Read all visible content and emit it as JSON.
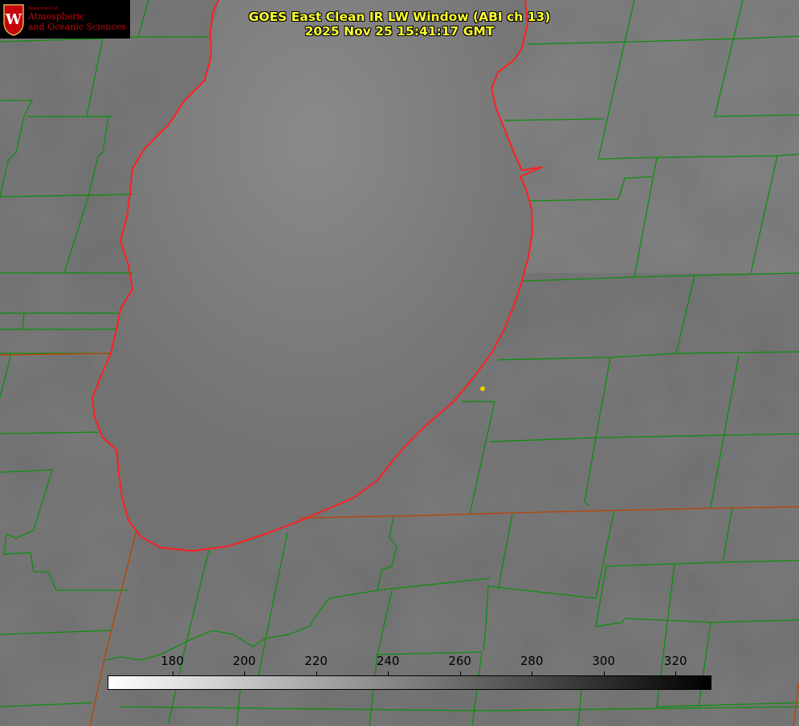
{
  "title": {
    "line1": "GOES East Clean IR LW Window (ABI ch 13)",
    "line2": "2025 Nov 25 15:41:17 GMT"
  },
  "logo": {
    "department": "Department of",
    "line1": "Atmospheric",
    "line2": "and Oceanic Sciences",
    "seal_letter": "W"
  },
  "colorbar": {
    "min_value": 162,
    "max_value": 330,
    "colormap": "white-to-black grayscale",
    "ticks": [
      "180",
      "200",
      "220",
      "240",
      "260",
      "280",
      "300",
      "320"
    ]
  },
  "colors": {
    "lake_shoreline": "#ff2020",
    "county_borders": "#0c8f0c",
    "state_borders": "#b24a10",
    "title_text": "#ffff33",
    "station_marker": "#e8d000"
  },
  "map": {
    "feature": "lake outline with county boundary overlay",
    "marker_icon": "station-dot-icon"
  }
}
